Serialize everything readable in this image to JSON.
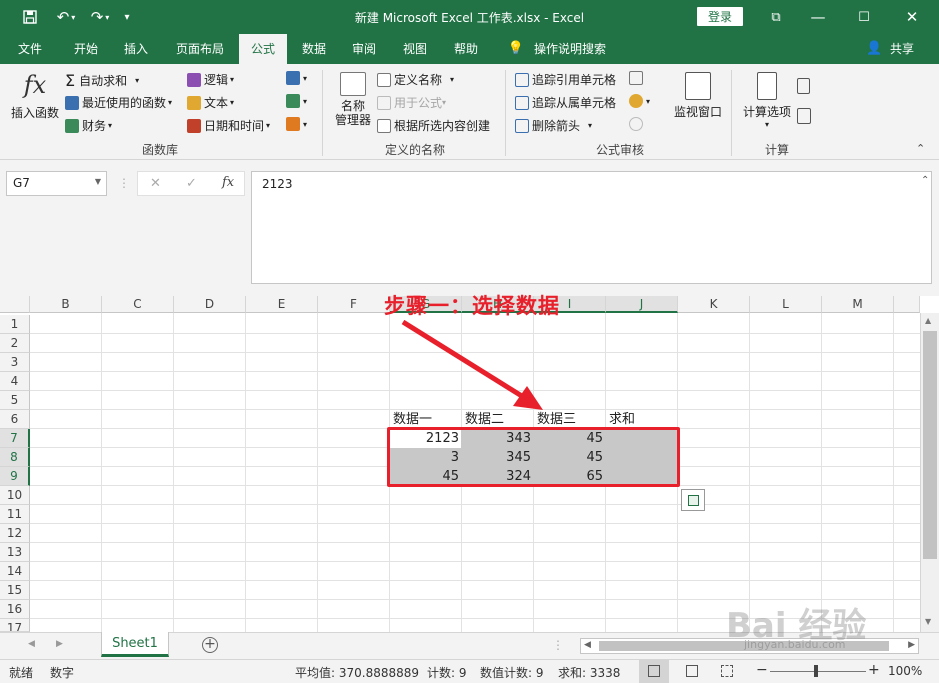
{
  "window": {
    "title": "新建 Microsoft Excel 工作表.xlsx  -  Excel",
    "login_label": "登录",
    "share_label": "共享"
  },
  "menu": {
    "tabs": [
      "文件",
      "开始",
      "插入",
      "页面布局",
      "公式",
      "数据",
      "审阅",
      "视图",
      "帮助"
    ],
    "active_tab": "公式",
    "tell_me": "操作说明搜索"
  },
  "ribbon": {
    "insert_function": "插入函数",
    "autosum": "自动求和",
    "recent": "最近使用的函数",
    "financial": "财务",
    "logical": "逻辑",
    "text": "文本",
    "datetime": "日期和时间",
    "group_library": "函数库",
    "name_manager": "名称\n管理器",
    "define_name": "定义名称",
    "use_in_formula": "用于公式",
    "create_from_selection": "根据所选内容创建",
    "group_defined_names": "定义的名称",
    "trace_precedents": "追踪引用单元格",
    "trace_dependents": "追踪从属单元格",
    "remove_arrows": "删除箭头",
    "watch_window": "监视窗口",
    "group_auditing": "公式审核",
    "calc_options": "计算选项",
    "group_calc": "计算"
  },
  "formula_bar": {
    "name_box": "G7",
    "fx": "fx",
    "value": "2123"
  },
  "grid": {
    "columns": [
      "B",
      "C",
      "D",
      "E",
      "F",
      "G",
      "H",
      "I",
      "J",
      "K",
      "L",
      "M"
    ],
    "rows": [
      "1",
      "2",
      "3",
      "4",
      "5",
      "6",
      "7",
      "8",
      "9",
      "10",
      "11",
      "12",
      "13",
      "14",
      "15",
      "16",
      "17"
    ],
    "headers": [
      "数据一",
      "数据二",
      "数据三",
      "求和"
    ],
    "data": [
      [
        "2123",
        "343",
        "45"
      ],
      [
        "3",
        "345",
        "45"
      ],
      [
        "45",
        "324",
        "65"
      ]
    ],
    "annotation": "步骤一：选择数据"
  },
  "sheets": {
    "tabs": [
      "Sheet1"
    ]
  },
  "status": {
    "ready": "就绪",
    "mode": "数字",
    "average": "平均值: 370.8888889",
    "count": "计数: 9",
    "numeric_count": "数值计数: 9",
    "sum": "求和: 3338",
    "zoom": "100%"
  },
  "watermark": {
    "main": "Bai 经验",
    "sub": "jingyan.baidu.com"
  },
  "colors": {
    "excel_green": "#217346",
    "annotation_red": "#e8202b"
  }
}
